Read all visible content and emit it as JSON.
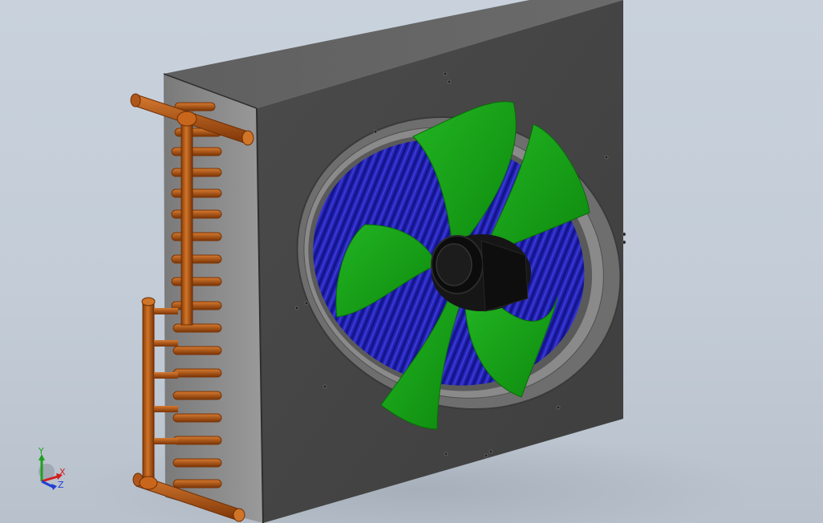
{
  "viewport": {
    "background_top": "#c9d2dc",
    "background_bottom": "#b8c1cc"
  },
  "model": {
    "housing_color": "#4a4a4a",
    "fin_color": "#1f1fb0",
    "blade_color": "#12a012",
    "hub_color": "#111111",
    "pipe_color": "#c8661c"
  },
  "triad": {
    "x_label": "X",
    "y_label": "Y",
    "z_label": "Z",
    "x_color": "#d21f1f",
    "y_color": "#1fa01f",
    "z_color": "#1f3fd2"
  }
}
